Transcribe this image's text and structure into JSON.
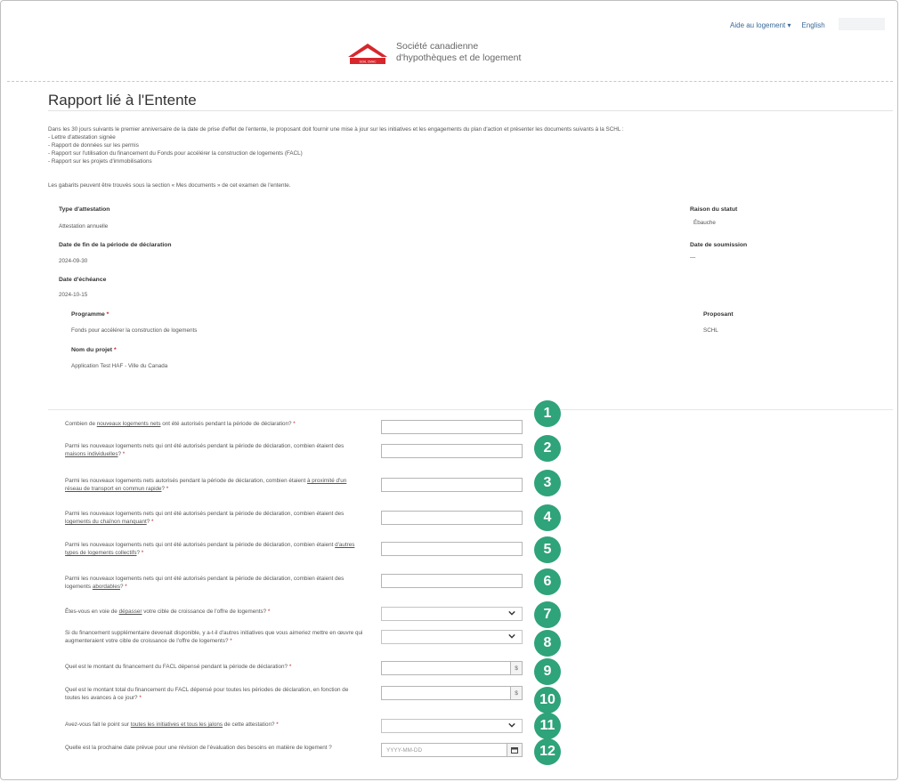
{
  "header": {
    "help_menu": "Aide au logement",
    "language_link": "English",
    "logo_line1": "Société canadienne",
    "logo_line2": "d'hypothèques et de logement",
    "logo_mark_text": "SCHL CMHC"
  },
  "page": {
    "title": "Rapport lié à l'Entente",
    "intro": "Dans les 30 jours suivants le premier anniversaire de la date de prise d'effet de l'entente, le proposant doit fournir une mise à jour sur les initiatives et les engagements du plan d'action et présenter les documents suivants à la SCHL :",
    "bullets": [
      "- Lettre d'attestation signée",
      "- Rapport de données sur les permis",
      "- Rapport sur l'utilisation du financement du Fonds pour accélérer la construction de logements (FACL)",
      "- Rapport sur les projets d'immobilisations"
    ],
    "note": "Les gabarits peuvent être trouvés sous la section « Mes documents » de cet examen de l'entente."
  },
  "details": {
    "attestation_type": {
      "label": "Type d'attestation",
      "value": "Attestation annuelle"
    },
    "status_reason": {
      "label": "Raison du statut",
      "value": "Ébauche"
    },
    "period_end": {
      "label": "Date de fin de la période de déclaration",
      "value": "2024-09-30"
    },
    "submission_date": {
      "label": "Date de soumission",
      "value": "—"
    },
    "due_date": {
      "label": "Date d'échéance",
      "value": "2024-10-15"
    },
    "program": {
      "label": "Programme",
      "value": "Fonds pour accélérer la construction de logements"
    },
    "proponent": {
      "label": "Proposant",
      "value": "SCHL"
    },
    "project_name": {
      "label": "Nom du projet",
      "value": "Application Test HAF - Ville du Canada"
    }
  },
  "questions": {
    "q1": {
      "pre": "Combien de ",
      "link": "nouveaux logements nets",
      "post": " ont été autorisés pendant la période de déclaration?",
      "badge": "1"
    },
    "q2": {
      "pre": "Parmi les nouveaux logements nets qui ont été autorisés pendant la période de déclaration, combien étaient des ",
      "link": "maisons individuelles",
      "post": "?",
      "badge": "2"
    },
    "q3": {
      "pre": "Parmi les nouveaux logements nets autorisés pendant la période de déclaration, combien étaient ",
      "link": "à proximité d'un réseau de transport en commun rapide",
      "post": "?",
      "badge": "3"
    },
    "q4": {
      "pre": "Parmi les nouveaux logements nets qui ont été autorisés pendant la période de déclaration, combien étaient des ",
      "link": "logements du chaînon manquant",
      "post": "?",
      "badge": "4"
    },
    "q5": {
      "pre": "Parmi les nouveaux logements nets qui ont été autorisés pendant la période de déclaration, combien étaient ",
      "link": "d'autres types de logements collectifs",
      "post": "?",
      "badge": "5"
    },
    "q6": {
      "pre": "Parmi les nouveaux logements nets qui ont été autorisés pendant la période de déclaration, combien étaient des logements ",
      "link": "abordables",
      "post": "?",
      "badge": "6"
    },
    "q7": {
      "pre": "Êtes-vous en voie de ",
      "link": "dépasser",
      "post": " votre cible de croissance de l'offre de logements?",
      "badge": "7"
    },
    "q8": {
      "pre": "Si du financement supplémentaire devenait disponible, y a-t-il d'autres initiatives que vous aimeriez mettre en œuvre qui augmenteraient votre cible de croissance de l'offre de logements?",
      "link": "",
      "post": "",
      "badge": "8"
    },
    "q9": {
      "pre": "Quel est le montant du financement du FACL dépensé pendant la période de déclaration?",
      "link": "",
      "post": "",
      "badge": "9"
    },
    "q10": {
      "pre": "Quel est le montant total du financement du FACL dépensé pour toutes les périodes de déclaration, en fonction de toutes les avances à ce jour?",
      "link": "",
      "post": "",
      "badge": "10"
    },
    "q11": {
      "pre": "Avez-vous fait le point sur ",
      "link": "toutes les initiatives et tous les jalons",
      "post": " de cette attestation?",
      "badge": "11"
    },
    "q12": {
      "pre": "Quelle est la prochaine date prévue pour une révision de l'évaluation des besoins en matière de logement ?",
      "link": "",
      "post": "",
      "badge": "12"
    }
  },
  "inputs": {
    "currency_symbol": "$",
    "date_placeholder": "YYYY-MM-DD",
    "required_marker": "*"
  },
  "colors": {
    "badge": "#2fa37a",
    "required": "#c0202b",
    "logo_red": "#d7262c"
  }
}
